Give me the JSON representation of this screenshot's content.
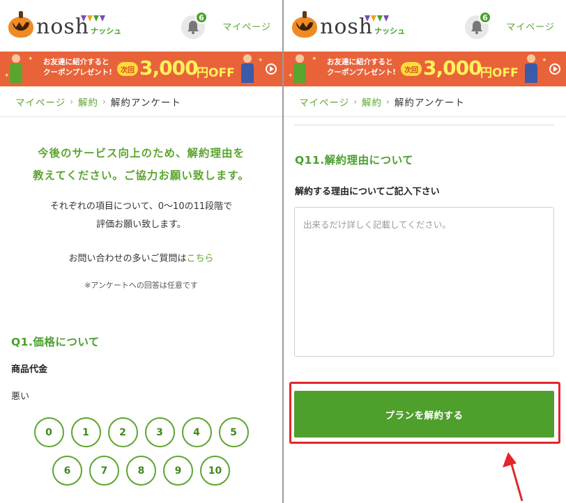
{
  "header": {
    "logo_text": "nosh",
    "logo_sub": "ナッシュ",
    "notification_count": "6",
    "mypage_label": "マイページ"
  },
  "banner": {
    "line1": "お友達に紹介すると",
    "line2": "クーポンプレゼント!",
    "badge": "次回",
    "amount": "3,000",
    "suffix": "円OFF"
  },
  "breadcrumb": {
    "home": "マイページ",
    "parent": "解約",
    "current": "解約アンケート",
    "separator": "›"
  },
  "left": {
    "intro_title_line1": "今後のサービス向上のため、解約理由を",
    "intro_title_line2": "教えてください。ご協力お願い致します。",
    "intro_desc_line1": "それぞれの項目について、0〜10の11段階で",
    "intro_desc_line2": "評価お願い致します。",
    "faq_text": "お問い合わせの多いご質問は",
    "faq_link": "こちら",
    "optional_note": "※アンケートへの回答は任意です",
    "question_title": "Q1.価格について",
    "question_label": "商品代金",
    "scale_low": "悪い",
    "rating_row1": [
      "0",
      "1",
      "2",
      "3",
      "4",
      "5"
    ],
    "rating_row2": [
      "6",
      "7",
      "8",
      "9",
      "10"
    ]
  },
  "right": {
    "question_title": "Q11.解約理由について",
    "field_label": "解約する理由についてご記入下さい",
    "textarea_placeholder": "出来るだけ詳しく記載してください。",
    "submit_label": "プランを解約する"
  },
  "colors": {
    "brand_green": "#5ba52f",
    "button_green": "#4e9f2b",
    "banner_orange": "#e9633a",
    "highlight_red": "#e2262c"
  }
}
